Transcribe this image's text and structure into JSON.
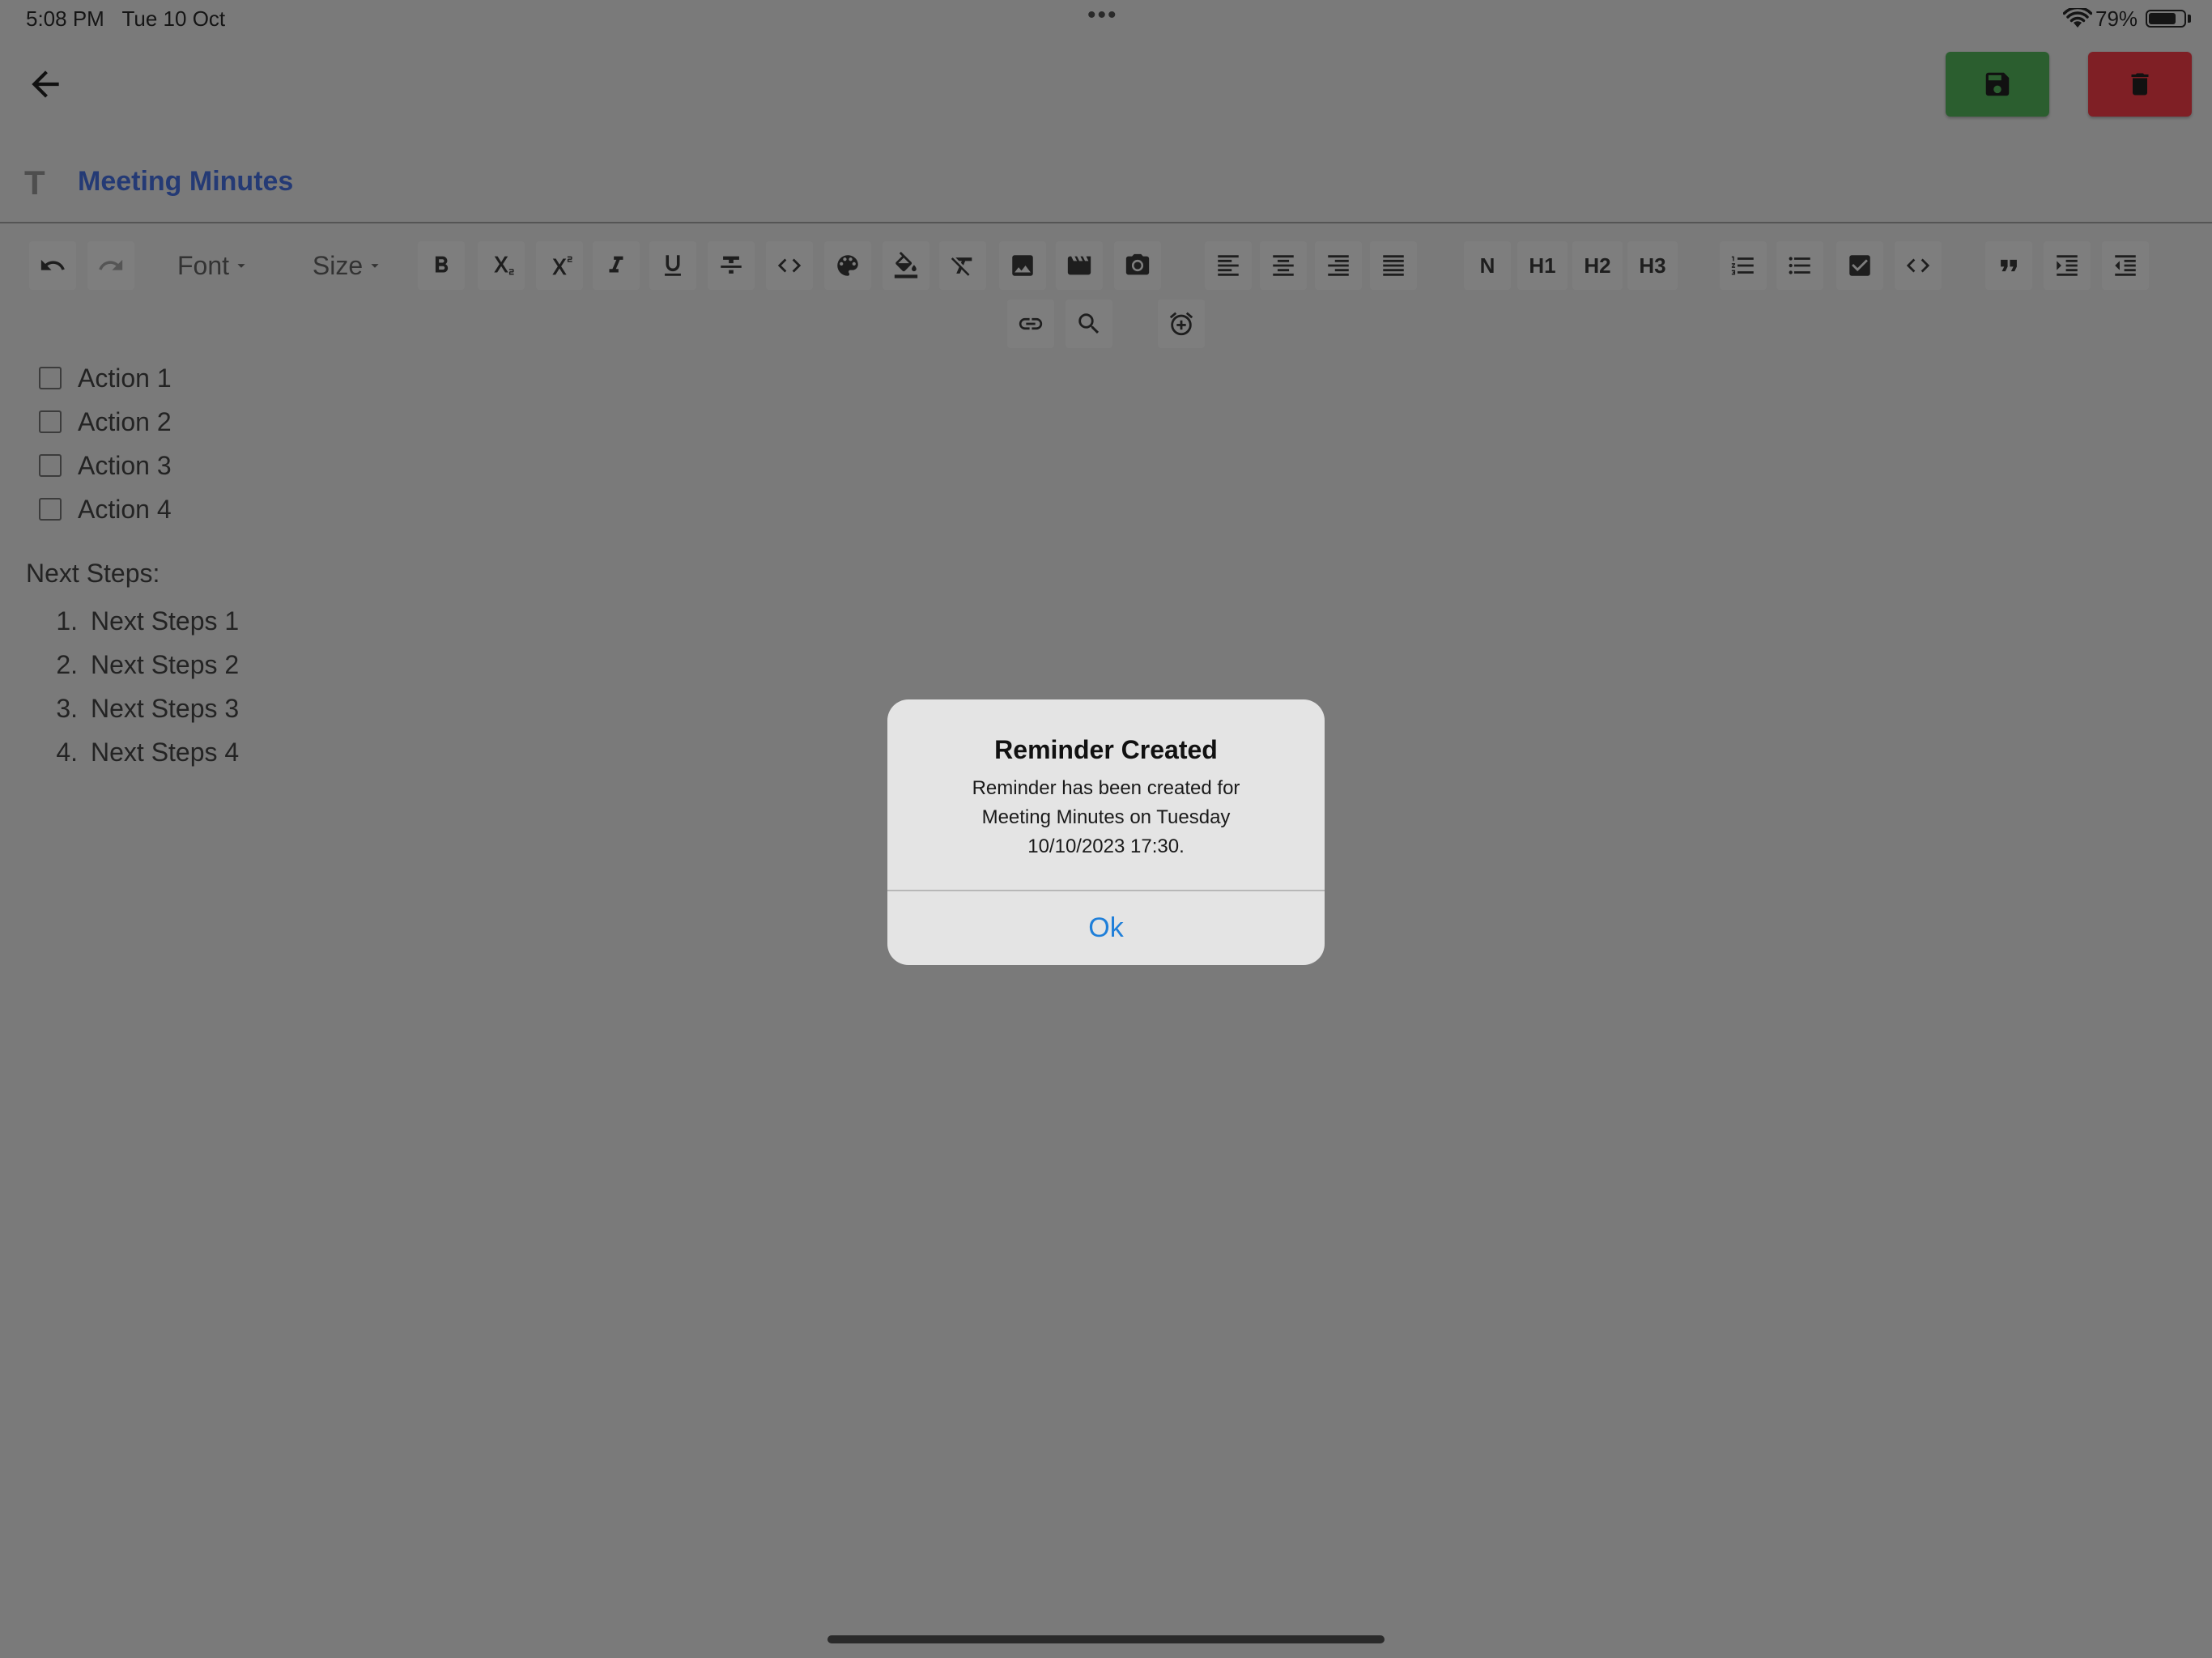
{
  "status_bar": {
    "time": "5:08 PM",
    "date": "Tue 10 Oct",
    "battery": "79%",
    "battery_level": 0.79,
    "multitask_icon": "ellipsis-icon",
    "wifi_icon": "wifi-icon",
    "battery_icon": "battery-icon"
  },
  "header": {
    "back_icon": "arrow-left-icon",
    "save_icon": "floppy-disk-icon",
    "delete_icon": "trash-icon",
    "save_color": "#2b5e2f",
    "delete_color": "#7f1f25"
  },
  "note": {
    "title_icon": "T",
    "title": "Meeting Minutes",
    "title_color": "#243a75"
  },
  "toolbar": {
    "font_label": "Font",
    "size_label": "Size",
    "heading_normal": "N",
    "heading_1": "H1",
    "heading_2": "H2",
    "heading_3": "H3",
    "icons": [
      "undo-icon",
      "redo-icon",
      "bold-icon",
      "subscript-icon",
      "superscript-icon",
      "italic-icon",
      "underline-icon",
      "strikethrough-icon",
      "code-icon",
      "text-color-icon",
      "fill-color-icon",
      "clear-format-icon",
      "image-icon",
      "video-icon",
      "camera-icon",
      "align-left-icon",
      "align-center-icon",
      "align-right-icon",
      "align-justify-icon",
      "ordered-list-icon",
      "bullet-list-icon",
      "checklist-icon",
      "code-block-icon",
      "quote-icon",
      "indent-icon",
      "outdent-icon",
      "link-icon",
      "search-icon",
      "add-alarm-icon"
    ]
  },
  "content": {
    "checklist": [
      {
        "label": "Action 1",
        "checked": false
      },
      {
        "label": "Action 2",
        "checked": false
      },
      {
        "label": "Action 3",
        "checked": false
      },
      {
        "label": "Action 4",
        "checked": false
      }
    ],
    "next_steps_label": "Next Steps:",
    "next_steps": [
      {
        "num": "1.",
        "label": "Next Steps 1"
      },
      {
        "num": "2.",
        "label": "Next Steps 2"
      },
      {
        "num": "3.",
        "label": "Next Steps 3"
      },
      {
        "num": "4.",
        "label": "Next Steps 4"
      }
    ]
  },
  "dialog": {
    "title": "Reminder Created",
    "message": "Reminder has been created for Meeting Minutes on Tuesday 10/10/2023 17:30.",
    "ok_label": "Ok",
    "ok_color": "#1f7fd9"
  }
}
